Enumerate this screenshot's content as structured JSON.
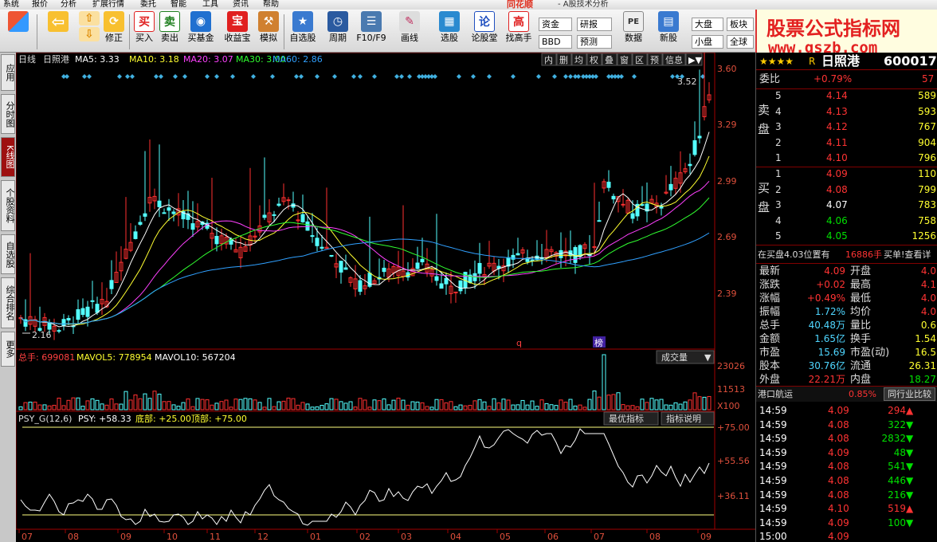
{
  "menu": {
    "items": [
      "系统",
      "报价",
      "分析",
      "扩展行情",
      "委托",
      "智能",
      "工具",
      "资讯",
      "帮助"
    ],
    "brand": "同花顺",
    "subtitle": "- A股技术分析"
  },
  "toolbar": {
    "buttons": [
      {
        "label": "",
        "icon": "layout-icon"
      },
      {
        "label": "",
        "icon": "back-arrow-icon"
      },
      {
        "label": "",
        "icon": "up-arrow-icon"
      },
      {
        "label": "修正",
        "icon": "refresh-icon"
      },
      {
        "label": "买入",
        "icon": "buy-icon",
        "glyph": "买"
      },
      {
        "label": "卖出",
        "icon": "sell-icon",
        "glyph": "卖"
      },
      {
        "label": "买基金",
        "icon": "fund-icon"
      },
      {
        "label": "收益宝",
        "icon": "treasure-icon",
        "glyph": "宝"
      },
      {
        "label": "模拟",
        "icon": "hammer-icon"
      },
      {
        "label": "自选股",
        "icon": "star-icon"
      },
      {
        "label": "周期",
        "icon": "clock-icon"
      },
      {
        "label": "F10/F9",
        "icon": "f10-icon"
      },
      {
        "label": "画线",
        "icon": "pencil-icon"
      },
      {
        "label": "选股",
        "icon": "select-icon"
      },
      {
        "label": "论股堂",
        "icon": "forum-icon",
        "glyph": "论"
      },
      {
        "label": "找高手",
        "icon": "expert-icon",
        "glyph": "高"
      },
      {
        "label": "数据",
        "icon": "pe-icon",
        "glyph": "PE"
      },
      {
        "label": "新股",
        "icon": "newstock-icon"
      }
    ],
    "small": [
      "资金",
      "研报",
      "BBD",
      "预测",
      "大盘",
      "板块",
      "小盘",
      "全球"
    ]
  },
  "banner": {
    "title": "股票公式指标网",
    "url": "www.gszb.com"
  },
  "left_tabs": [
    "应用",
    "分时图",
    "K线图",
    "个股资料",
    "自选股",
    "综合排名",
    "更多"
  ],
  "chart": {
    "header": {
      "period": "日线",
      "name": "日照港",
      "ma5": "MA5: 3.33",
      "ma10": "MA10: 3.18",
      "ma20": "MA20: 3.07",
      "ma30": "MA30: 3.00",
      "ma60": "MA60: 2.86"
    },
    "buttons": [
      "内",
      "删",
      "均",
      "权",
      "叠",
      "窗",
      "区",
      "预",
      "信息"
    ],
    "price_axis": [
      "3.60",
      "3.29",
      "2.99",
      "2.69",
      "2.39"
    ],
    "price_high": "3.52",
    "price_low": "2.16",
    "marker_q": "q",
    "marker_bang": "榜",
    "vol_header": {
      "total": "总手: 699081",
      "mavol5": "MAVOL5: 778954",
      "mavol10": "MAVOL10: 567204"
    },
    "vol_selector": "成交量",
    "vol_axis": [
      "23026",
      "11513",
      "X100"
    ],
    "psy_header": {
      "name": "PSY_G(12,6)",
      "psy": "PSY: +58.33",
      "bottom": "底部: +25.00",
      "top": "顶部: +75.00"
    },
    "psy_buttons": [
      "最优指标",
      "指标说明"
    ],
    "psy_axis": [
      "+75.00",
      "+55.56",
      "+36.11"
    ],
    "months": [
      "07",
      "08",
      "09",
      "10",
      "11",
      "12",
      "01",
      "02",
      "03",
      "04",
      "05",
      "06",
      "07",
      "08",
      "09"
    ],
    "colors": {
      "ma5": "#ffffff",
      "ma10": "#ffff30",
      "ma20": "#ff40ff",
      "ma30": "#30ff30",
      "ma60": "#30a0ff",
      "up": "#ff3030",
      "down": "#54ffff"
    }
  },
  "quote": {
    "title": "日照港",
    "code": "600017",
    "stars": "★★★★",
    "rflag": "R",
    "weibi_label": "委比",
    "weibi_val": "+0.79%",
    "weibi_cnt": "57",
    "sell_label": "卖盘",
    "buy_label": "买盘",
    "sell": [
      {
        "lv": "5",
        "p": "4.14",
        "v": "589"
      },
      {
        "lv": "4",
        "p": "4.13",
        "v": "593"
      },
      {
        "lv": "3",
        "p": "4.12",
        "v": "767"
      },
      {
        "lv": "2",
        "p": "4.11",
        "v": "904"
      },
      {
        "lv": "1",
        "p": "4.10",
        "v": "796"
      }
    ],
    "buy": [
      {
        "lv": "1",
        "p": "4.09",
        "v": "110"
      },
      {
        "lv": "2",
        "p": "4.08",
        "v": "799"
      },
      {
        "lv": "3",
        "p": "4.07",
        "v": "783"
      },
      {
        "lv": "4",
        "p": "4.06",
        "v": "758"
      },
      {
        "lv": "5",
        "p": "4.05",
        "v": "1256"
      }
    ],
    "notice": "在买盘4.03位置有",
    "notice_vol": "16886手",
    "notice_link": "买单!查看详",
    "stats": [
      {
        "l": "最新",
        "v": "4.09",
        "l2": "开盘",
        "v2": "4.0"
      },
      {
        "l": "涨跌",
        "v": "+0.02",
        "l2": "最高",
        "v2": "4.1"
      },
      {
        "l": "涨幅",
        "v": "+0.49%",
        "l2": "最低",
        "v2": "4.0"
      },
      {
        "l": "振幅",
        "v": "1.72%",
        "l2": "均价",
        "v2": "4.0"
      },
      {
        "l": "总手",
        "v": "40.48万",
        "l2": "量比",
        "v2": "0.6"
      },
      {
        "l": "金额",
        "v": "1.65亿",
        "l2": "换手",
        "v2": "1.54"
      },
      {
        "l": "市盈",
        "v": "15.69",
        "l2": "市盈(动)",
        "v2": "16.5"
      },
      {
        "l": "股本",
        "v": "30.76亿",
        "l2": "流通",
        "v2": "26.31"
      },
      {
        "l": "外盘",
        "v": "22.21万",
        "l2": "内盘",
        "v2": "18.27"
      }
    ],
    "sector": "港口航运",
    "sector_chg": "0.85%",
    "sector_btn": "同行业比较",
    "ticks": [
      {
        "t": "14:59",
        "p": "4.09",
        "v": "294",
        "d": "up"
      },
      {
        "t": "14:59",
        "p": "4.08",
        "v": "322",
        "d": "down"
      },
      {
        "t": "14:59",
        "p": "4.08",
        "v": "2832",
        "d": "down"
      },
      {
        "t": "14:59",
        "p": "4.09",
        "v": "48",
        "d": "down"
      },
      {
        "t": "14:59",
        "p": "4.08",
        "v": "541",
        "d": "down"
      },
      {
        "t": "14:59",
        "p": "4.08",
        "v": "446",
        "d": "down"
      },
      {
        "t": "14:59",
        "p": "4.08",
        "v": "216",
        "d": "down"
      },
      {
        "t": "14:59",
        "p": "4.10",
        "v": "519",
        "d": "up"
      },
      {
        "t": "14:59",
        "p": "4.09",
        "v": "100",
        "d": "down"
      },
      {
        "t": "15:00",
        "p": "4.09",
        "v": "",
        "d": ""
      }
    ]
  }
}
